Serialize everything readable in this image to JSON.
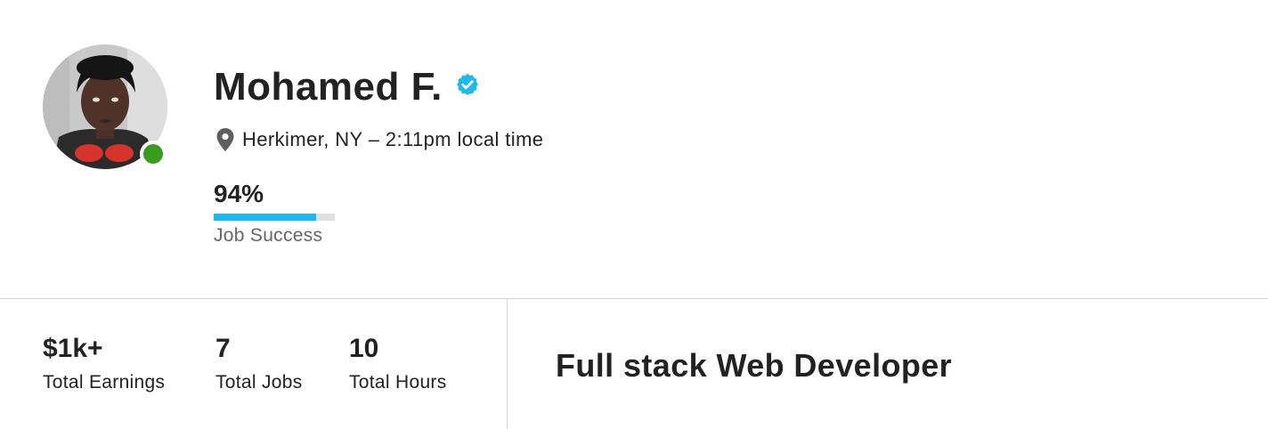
{
  "profile": {
    "name": "Mohamed F.",
    "verified": true,
    "online": true,
    "location": "Herkimer, NY – 2:11pm local time",
    "job_success": {
      "value_text": "94%",
      "value": 0.94,
      "label": "Job Success"
    }
  },
  "stats": [
    {
      "value": "$1k+",
      "label": "Total Earnings"
    },
    {
      "value": "7",
      "label": "Total Jobs"
    },
    {
      "value": "10",
      "label": "Total Hours"
    }
  ],
  "headline": "Full stack Web Developer",
  "colors": {
    "accent": "#1cb8f0",
    "online": "#3a9c1c",
    "verified": "#1cb8f0",
    "text": "#222222",
    "muted": "#666666",
    "divider": "#d5d5d5"
  },
  "icons": {
    "verified": "verified-badge-icon",
    "location": "map-pin-icon",
    "online": "online-status-icon"
  }
}
